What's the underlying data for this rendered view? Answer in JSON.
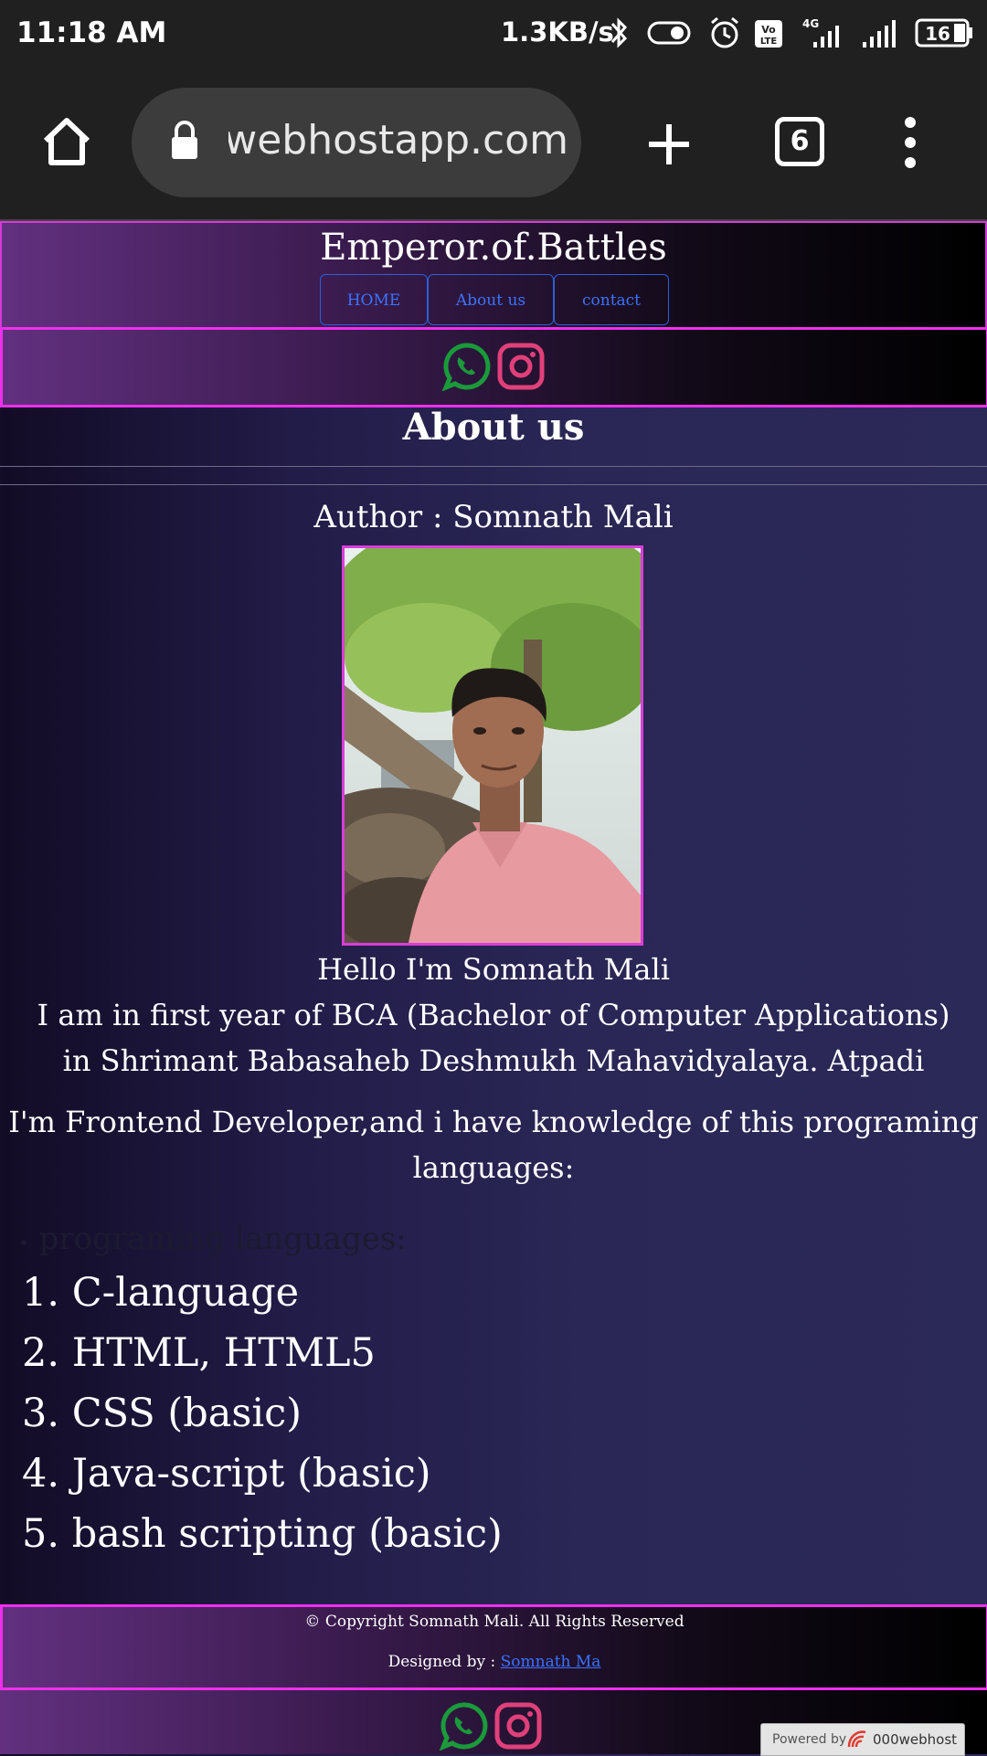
{
  "status_bar": {
    "time": "11:18 AM",
    "network_speed": "1.3KB/s",
    "battery": "16",
    "signal_label": "4G",
    "volte": "Vo LTE"
  },
  "browser": {
    "url": "webhostapp.com",
    "tab_count": "6"
  },
  "site": {
    "title": "Emperor.of.Battles",
    "nav": [
      "HOME",
      "About us",
      "contact"
    ]
  },
  "main": {
    "heading": "About us",
    "author": "Author : Somnath Mali",
    "bio_line1": "Hello I'm Somnath Mali",
    "bio_line2": "I am in first year of BCA (Bachelor of Computer Applications)",
    "bio_line3": "in Shrimant Babasaheb Deshmukh Mahavidyalaya. Atpadi",
    "dev_line1": "I'm Frontend Developer,and i have knowledge of this programing",
    "dev_line2": "languages:",
    "list_heading": "programing languages:",
    "languages": [
      "1. C-language",
      "2. HTML, HTML5",
      "3. CSS (basic)",
      "4. Java-script (basic)",
      "5. bash scripting (basic)"
    ]
  },
  "footer": {
    "copyright": "© Copyright Somnath Mali. All Rights Reserved",
    "designed_by": "Designed by : ",
    "designer_link": "Somnath Ma",
    "powered_by": "Powered by",
    "host": "000webhost"
  },
  "colors": {
    "accent_border": "#ee30ee",
    "link": "#3b73ff",
    "whatsapp": "#1a9a3a",
    "instagram": "#e0407a"
  }
}
